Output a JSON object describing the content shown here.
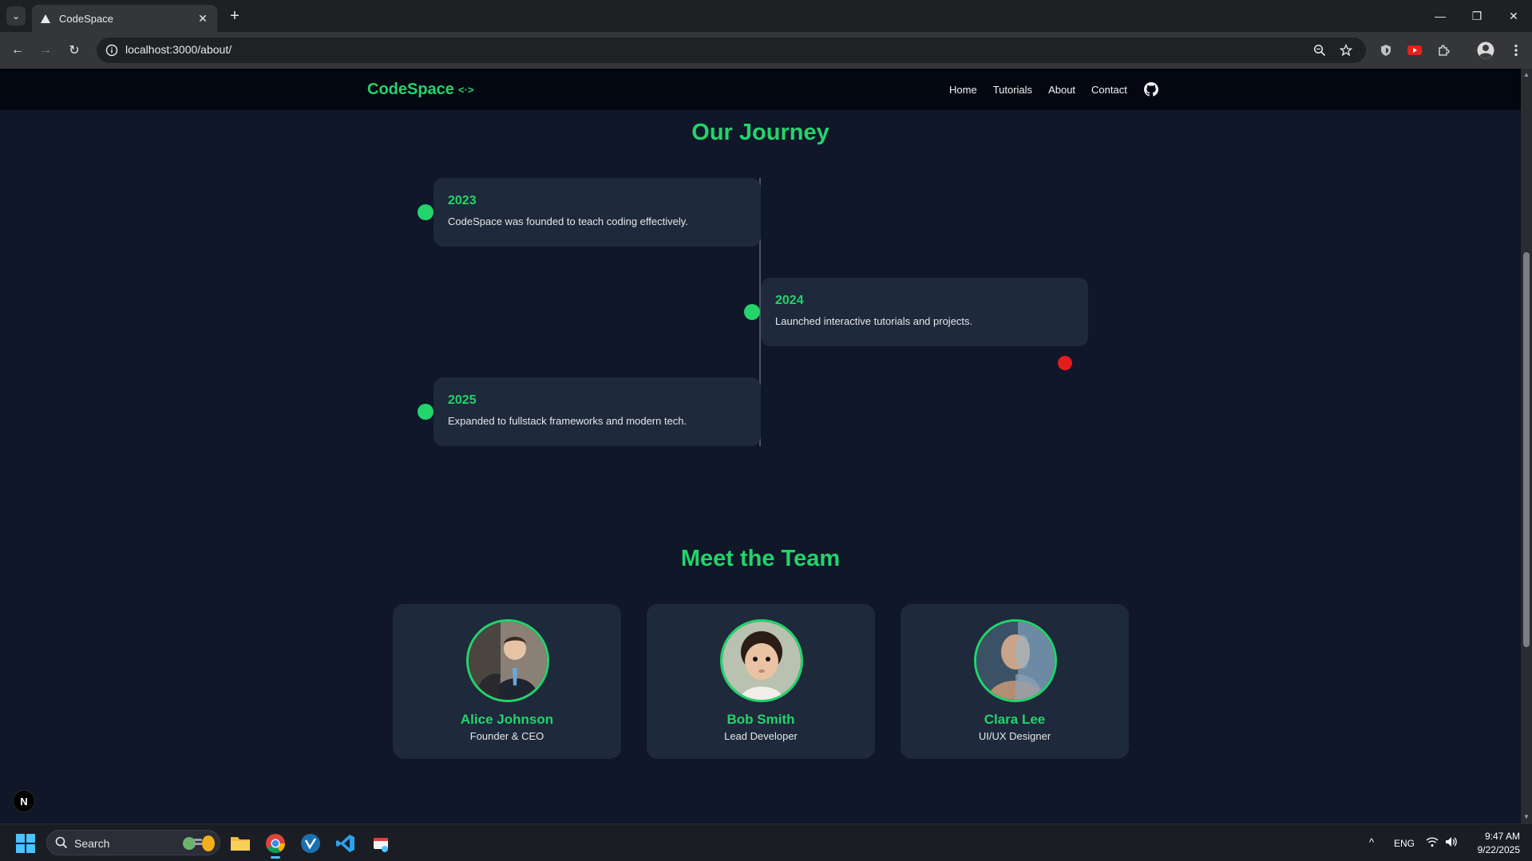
{
  "browser": {
    "tab_title": "CodeSpace",
    "url": "localhost:3000/about/",
    "new_tab_glyph": "+",
    "close_glyph": "✕",
    "minimize_glyph": "—",
    "restore_glyph": "❐",
    "window_close_glyph": "✕",
    "back_glyph": "←",
    "forward_glyph": "→",
    "reload_glyph": "↻",
    "tab_menu_glyph": "⌄"
  },
  "site": {
    "brand": "CodeSpace",
    "brand_icon_glyph": "<·>",
    "nav": [
      "Home",
      "Tutorials",
      "About",
      "Contact"
    ],
    "accent_color": "#22d46a"
  },
  "journey": {
    "title": "Our Journey",
    "events": [
      {
        "year": "2023",
        "text": "CodeSpace was founded to teach coding effectively."
      },
      {
        "year": "2024",
        "text": "Launched interactive tutorials and projects."
      },
      {
        "year": "2025",
        "text": "Expanded to fullstack frameworks and modern tech."
      }
    ]
  },
  "team": {
    "title": "Meet the Team",
    "members": [
      {
        "name": "Alice Johnson",
        "role": "Founder & CEO"
      },
      {
        "name": "Bob Smith",
        "role": "Lead Developer"
      },
      {
        "name": "Clara Lee",
        "role": "UI/UX Designer"
      }
    ]
  },
  "devtools_badge": "N",
  "taskbar": {
    "search_label": "Search",
    "language": "ENG",
    "time": "9:47 AM",
    "date": "9/22/2025",
    "tray_chevron": "^"
  }
}
